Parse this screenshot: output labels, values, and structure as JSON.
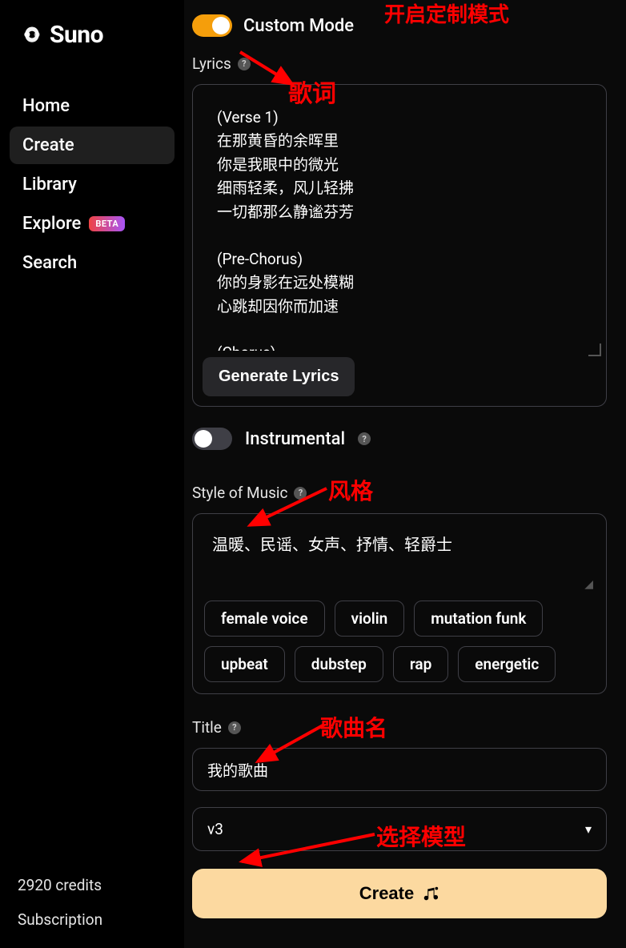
{
  "brand": {
    "name": "Suno"
  },
  "sidebar": {
    "items": [
      {
        "label": "Home"
      },
      {
        "label": "Create"
      },
      {
        "label": "Library"
      },
      {
        "label": "Explore",
        "badge": "BETA"
      },
      {
        "label": "Search"
      }
    ],
    "credits_text": "2920 credits",
    "subscription_label": "Subscription"
  },
  "custom_mode": {
    "label": "Custom Mode",
    "enabled": true
  },
  "lyrics": {
    "label": "Lyrics",
    "text": "(Verse 1)\n在那黄昏的余晖里\n你是我眼中的微光\n细雨轻柔，风儿轻拂\n一切都那么静谧芬芳\n\n(Pre-Chorus)\n你的身影在远处模糊\n心跳却因你而加速\n\n(Chorus)",
    "generate_button": "Generate Lyrics"
  },
  "instrumental": {
    "label": "Instrumental",
    "enabled": false
  },
  "style": {
    "label": "Style of Music",
    "value": "温暖、民谣、女声、抒情、轻爵士",
    "tags": [
      "female voice",
      "violin",
      "mutation funk",
      "upbeat",
      "dubstep",
      "rap",
      "energetic"
    ]
  },
  "title": {
    "label": "Title",
    "value": "我的歌曲"
  },
  "model": {
    "value": "v3"
  },
  "create_button": "Create",
  "annotations": {
    "custom_mode": "开启定制模式",
    "lyrics": "歌词",
    "style": "风格",
    "title": "歌曲名",
    "model": "选择模型"
  }
}
